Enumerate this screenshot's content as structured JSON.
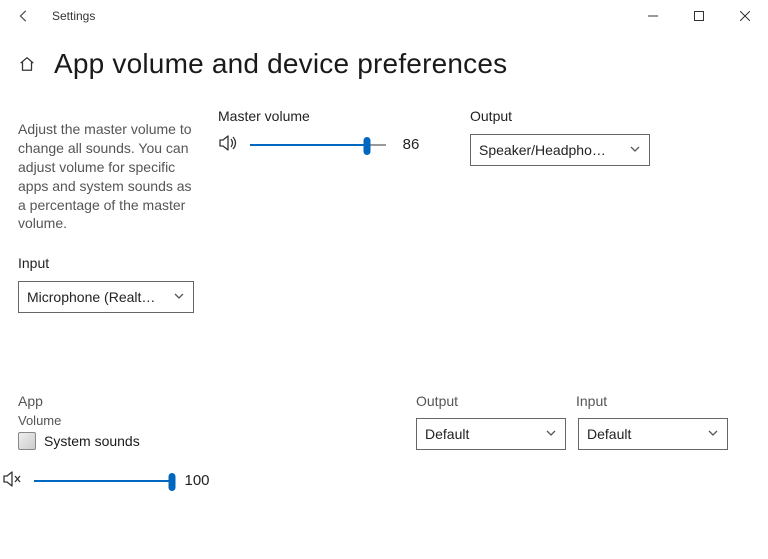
{
  "window": {
    "title": "Settings"
  },
  "page": {
    "title": "App volume and device preferences",
    "description": "Adjust the master volume to change all sounds. You can adjust volume for specific apps and system sounds as a percentage of the master volume."
  },
  "master": {
    "label": "Master volume",
    "value": 86
  },
  "output": {
    "label": "Output",
    "selected": "Speaker/Headpho…"
  },
  "input": {
    "label": "Input",
    "selected": "Microphone (Realt…"
  },
  "apps": {
    "header_app": "App",
    "header_volume": "Volume",
    "header_output": "Output",
    "header_input": "Input",
    "rows": [
      {
        "name": "System sounds",
        "output": "Default",
        "input": "Default",
        "volume": 100
      }
    ]
  }
}
